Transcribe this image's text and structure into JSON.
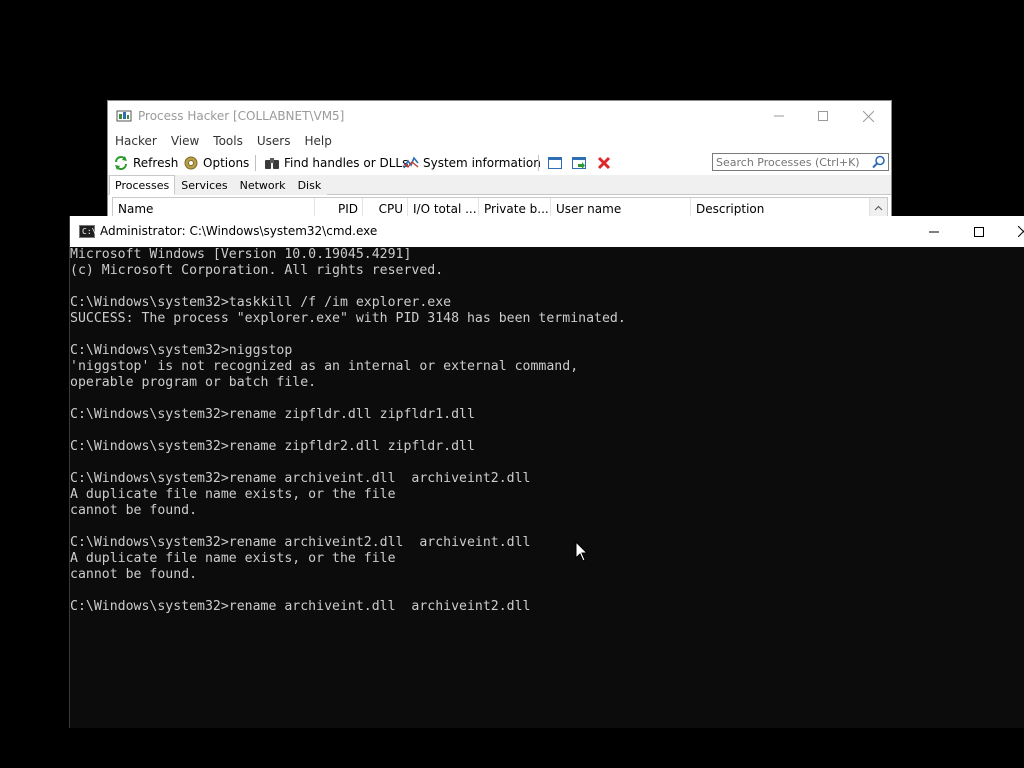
{
  "process_hacker": {
    "title": "Process Hacker [COLLABNET\\VM5]",
    "menu": [
      "Hacker",
      "View",
      "Tools",
      "Users",
      "Help"
    ],
    "toolbar": {
      "refresh": "Refresh",
      "options": "Options",
      "find_handles": "Find handles or DLLs",
      "system_info": "System information"
    },
    "search_placeholder": "Search Processes (Ctrl+K)",
    "tabs": [
      "Processes",
      "Services",
      "Network",
      "Disk"
    ],
    "active_tab": "Processes",
    "columns": [
      "Name",
      "PID",
      "CPU",
      "I/O total ...",
      "Private b...",
      "User name",
      "Description"
    ]
  },
  "cmd": {
    "title": "Administrator: C:\\Windows\\system32\\cmd.exe",
    "lines": [
      "Microsoft Windows [Version 10.0.19045.4291]",
      "(c) Microsoft Corporation. All rights reserved.",
      "",
      "C:\\Windows\\system32>taskkill /f /im explorer.exe",
      "SUCCESS: The process \"explorer.exe\" with PID 3148 has been terminated.",
      "",
      "C:\\Windows\\system32>niggstop",
      "'niggstop' is not recognized as an internal or external command,",
      "operable program or batch file.",
      "",
      "C:\\Windows\\system32>rename zipfldr.dll zipfldr1.dll",
      "",
      "C:\\Windows\\system32>rename zipfldr2.dll zipfldr.dll",
      "",
      "C:\\Windows\\system32>rename archiveint.dll  archiveint2.dll",
      "A duplicate file name exists, or the file",
      "cannot be found.",
      "",
      "C:\\Windows\\system32>rename archiveint2.dll  archiveint.dll",
      "A duplicate file name exists, or the file",
      "cannot be found.",
      "",
      "C:\\Windows\\system32>rename archiveint.dll  archiveint2.dll"
    ]
  },
  "colors": {
    "desktop": "#000000",
    "console_bg": "#0c0c0c",
    "console_text": "#cccccc",
    "close_red": "#e81123"
  }
}
